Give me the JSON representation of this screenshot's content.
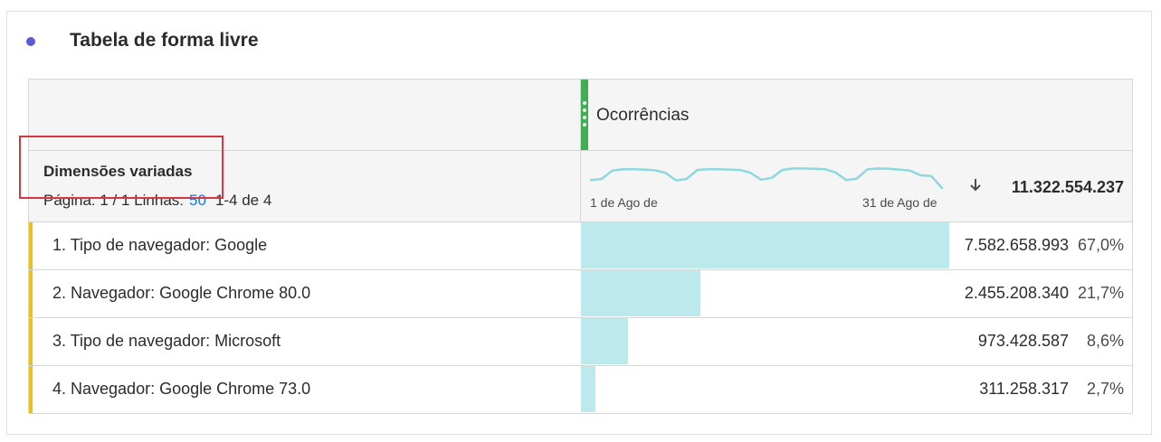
{
  "panel": {
    "title": "Tabela de forma livre",
    "colors": {
      "dot": "#5a5ad6",
      "highlight_box": "#d7373f"
    }
  },
  "table": {
    "metric": {
      "name": "Ocorrências",
      "color": "#3fae55"
    },
    "dimension_header": {
      "title": "Dimensões variadas",
      "pagination": {
        "page_label": "Página: 1 / 1 Linhas:",
        "rows_per_page": "50",
        "range": "1-4 de 4"
      }
    },
    "sparkline": {
      "start_label": "1 de Ago de",
      "end_label": "31 de Ago de",
      "color": "#8ed8df",
      "values": [
        0.42,
        0.45,
        0.68,
        0.72,
        0.72,
        0.71,
        0.69,
        0.62,
        0.41,
        0.45,
        0.7,
        0.72,
        0.72,
        0.71,
        0.7,
        0.62,
        0.43,
        0.48,
        0.7,
        0.74,
        0.74,
        0.73,
        0.72,
        0.63,
        0.42,
        0.46,
        0.72,
        0.74,
        0.73,
        0.71,
        0.68,
        0.55,
        0.53,
        0.2
      ]
    },
    "sort_icon": "arrow-down-icon",
    "total": "11.322.554.237",
    "rows": [
      {
        "label": "1. Tipo de navegador: Google",
        "value": "7.582.658.993",
        "pct": "67,0%",
        "share": 0.67
      },
      {
        "label": "2. Navegador: Google Chrome 80.0",
        "value": "2.455.208.340",
        "pct": "21,7%",
        "share": 0.217
      },
      {
        "label": "3. Tipo de navegador: Microsoft",
        "value": "973.428.587",
        "pct": "8,6%",
        "share": 0.086
      },
      {
        "label": "4. Navegador: Google Chrome 73.0",
        "value": "311.258.317",
        "pct": "2,7%",
        "share": 0.027
      }
    ],
    "row_accent_color": "#e5c21d",
    "bar_color": "#bce9ec"
  }
}
